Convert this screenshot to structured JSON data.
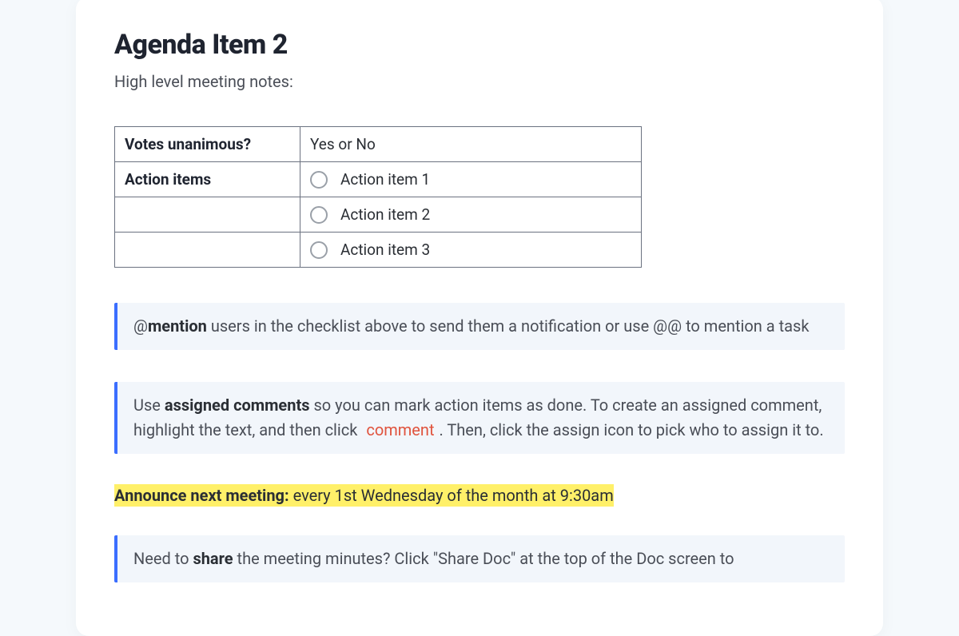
{
  "heading": "Agenda Item 2",
  "subtitle": "High level meeting notes:",
  "table": {
    "row1_label": "Votes unanimous?",
    "row1_value": "Yes or No",
    "row2_label": "Action items",
    "items": [
      "Action item 1",
      "Action item 2",
      "Action item 3"
    ]
  },
  "callout1": {
    "prefix": "@",
    "bold": "mention",
    "rest": " users in the checklist above to send them a notification or use @@ to mention a task"
  },
  "callout2": {
    "pre": "Use ",
    "bold": "assigned comments",
    "mid": " so you can mark action items as done. To create an assigned comment, highlight the text, and then click ",
    "pill": "comment",
    "post": ". Then, click the assign icon to pick who to assign it to."
  },
  "announce": {
    "bold": "Announce next meeting:",
    "rest": " every 1st Wednesday of the month at 9:30am"
  },
  "callout3": {
    "pre": "Need to ",
    "bold": "share",
    "rest": " the meeting minutes? Click \"Share Doc\" at the top of the Doc screen to"
  }
}
